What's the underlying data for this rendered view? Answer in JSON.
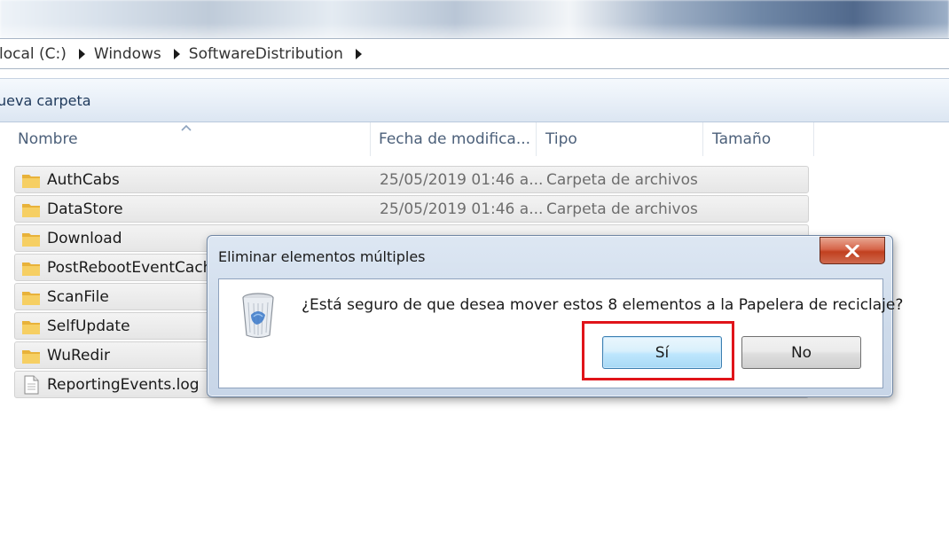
{
  "breadcrumb": {
    "items": [
      "local (C:)",
      "Windows",
      "SoftwareDistribution"
    ]
  },
  "toolbar": {
    "new_folder_label": "ueva carpeta"
  },
  "columns": {
    "name": "Nombre",
    "date": "Fecha de modifica...",
    "type": "Tipo",
    "size": "Tamaño"
  },
  "files": [
    {
      "name": "AuthCabs",
      "date": "25/05/2019 01:46 a...",
      "type": "Carpeta de archivos",
      "icon": "folder-icon"
    },
    {
      "name": "DataStore",
      "date": "25/05/2019 01:46 a...",
      "type": "Carpeta de archivos",
      "icon": "folder-icon"
    },
    {
      "name": "Download",
      "date": "",
      "type": "",
      "icon": "folder-icon"
    },
    {
      "name": "PostRebootEventCach",
      "date": "",
      "type": "",
      "icon": "folder-icon"
    },
    {
      "name": "ScanFile",
      "date": "",
      "type": "",
      "icon": "folder-icon"
    },
    {
      "name": "SelfUpdate",
      "date": "",
      "type": "",
      "icon": "folder-icon"
    },
    {
      "name": "WuRedir",
      "date": "",
      "type": "",
      "icon": "folder-icon"
    },
    {
      "name": "ReportingEvents.log",
      "date": "",
      "type": "",
      "icon": "document-icon"
    }
  ],
  "dialog": {
    "title": "Eliminar elementos múltiples",
    "message": "¿Está seguro de que desea mover estos 8 elementos a la Papelera de reciclaje?",
    "yes_label": "Sí",
    "no_label": "No",
    "icon": "recycle-bin-icon"
  },
  "colors": {
    "highlight": "#e0141a",
    "folder": "#f2c14e",
    "close_button": "#c1401f"
  }
}
